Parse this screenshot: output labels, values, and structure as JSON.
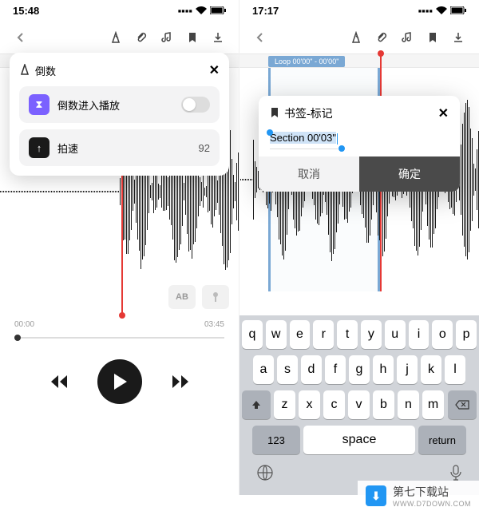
{
  "left": {
    "time": "15:48",
    "popup": {
      "title": "倒数",
      "row1_label": "倒数进入播放",
      "row2_label": "拍速",
      "row2_value": "92"
    },
    "ab_label": "AB",
    "time_start": "00:00",
    "time_end": "03:45"
  },
  "right": {
    "time": "17:17",
    "loop_label": "Loop 00'00\" - 00'00\"",
    "dialog": {
      "title": "书签-标记",
      "input_value": "Section 00'03\"",
      "cancel": "取消",
      "ok": "确定"
    },
    "keys_r1": [
      "q",
      "w",
      "e",
      "r",
      "t",
      "y",
      "u",
      "i",
      "o",
      "p"
    ],
    "keys_r2": [
      "a",
      "s",
      "d",
      "f",
      "g",
      "h",
      "j",
      "k",
      "l"
    ],
    "keys_r3": [
      "z",
      "x",
      "c",
      "v",
      "b",
      "n",
      "m"
    ],
    "key_123": "123",
    "key_space": "space",
    "key_return": "return"
  },
  "footer": {
    "brand": "第七下载站",
    "url": "WWW.D7DOWN.COM"
  }
}
